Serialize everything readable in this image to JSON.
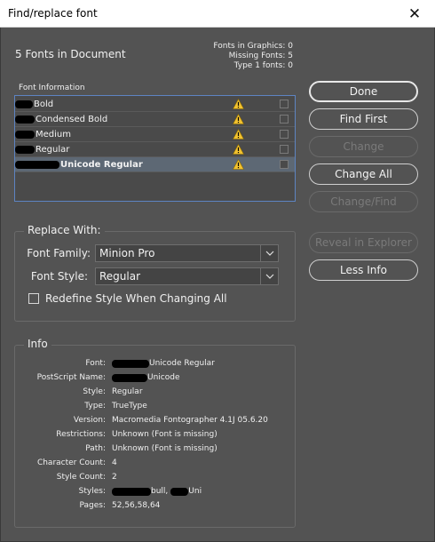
{
  "window": {
    "title": "Find/replace font",
    "close_glyph": "✕"
  },
  "summary": {
    "doc_fonts": "5 Fonts in Document",
    "stats": [
      "Fonts in Graphics: 0",
      "Missing Fonts: 5",
      "Type 1 fonts: 0"
    ]
  },
  "font_list": {
    "label": "Font Information",
    "rows": [
      {
        "name": "Bold",
        "status_icon": "warning-icon"
      },
      {
        "name": "Condensed Bold",
        "status_icon": "warning-icon"
      },
      {
        "name": "Medium",
        "status_icon": "warning-icon"
      },
      {
        "name": "Regular",
        "status_icon": "warning-icon"
      },
      {
        "name": "Unicode Regular",
        "status_icon": "warning-icon",
        "selected": true
      }
    ]
  },
  "buttons": {
    "done": "Done",
    "find_first": "Find First",
    "change": "Change",
    "change_all": "Change All",
    "change_find": "Change/Find",
    "reveal": "Reveal in Explorer",
    "less_info": "Less Info"
  },
  "replace_with": {
    "title": "Replace With:",
    "family_label": "Font Family:",
    "family_value": "Minion Pro",
    "style_label": "Font Style:",
    "style_value": "Regular",
    "redefine_label": "Redefine Style When Changing All",
    "redefine_checked": false
  },
  "info": {
    "title": "Info",
    "labels": [
      "Font:",
      "PostScript Name:",
      "Style:",
      "Type:",
      "Version:",
      "Restrictions:",
      "Path:",
      "Character Count:",
      "Style Count:",
      "Styles:",
      "Pages:"
    ],
    "font": "Unicode Regular",
    "postscript": "Unicode",
    "style": "Regular",
    "type": "TrueType",
    "version": "Macromedia Fontographer 4.1J 05.6.20",
    "restrictions": "Unknown (Font is missing)",
    "path": "Unknown (Font is missing)",
    "char_count": "4",
    "style_count": "2",
    "styles_a": "bull,",
    "styles_b": "Uni",
    "pages": "52,56,58,64"
  },
  "colors": {
    "background": "#535353",
    "selection": "#5d6874",
    "list_border": "#5d84c2",
    "warning": "#f2c230"
  }
}
